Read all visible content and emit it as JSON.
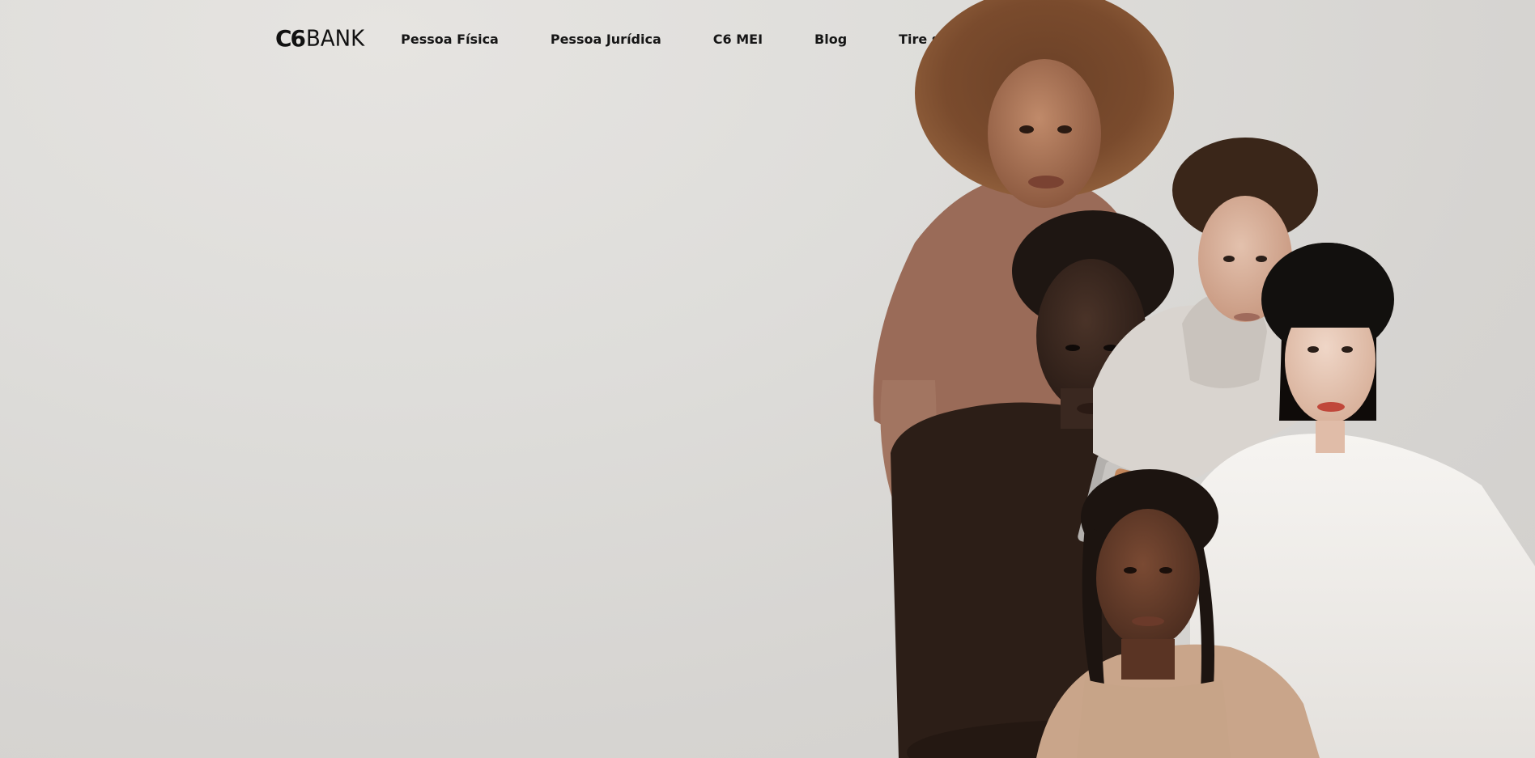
{
  "brand": {
    "mark": "C6",
    "word": "BANK"
  },
  "nav": {
    "items": [
      {
        "label": "Pessoa Física"
      },
      {
        "label": "Pessoa Jurídica"
      },
      {
        "label": "C6 MEI"
      },
      {
        "label": "Blog"
      },
      {
        "label": "Tire suas dúvidas"
      }
    ]
  },
  "colors": {
    "background": "#dcdad7",
    "text": "#161616"
  }
}
